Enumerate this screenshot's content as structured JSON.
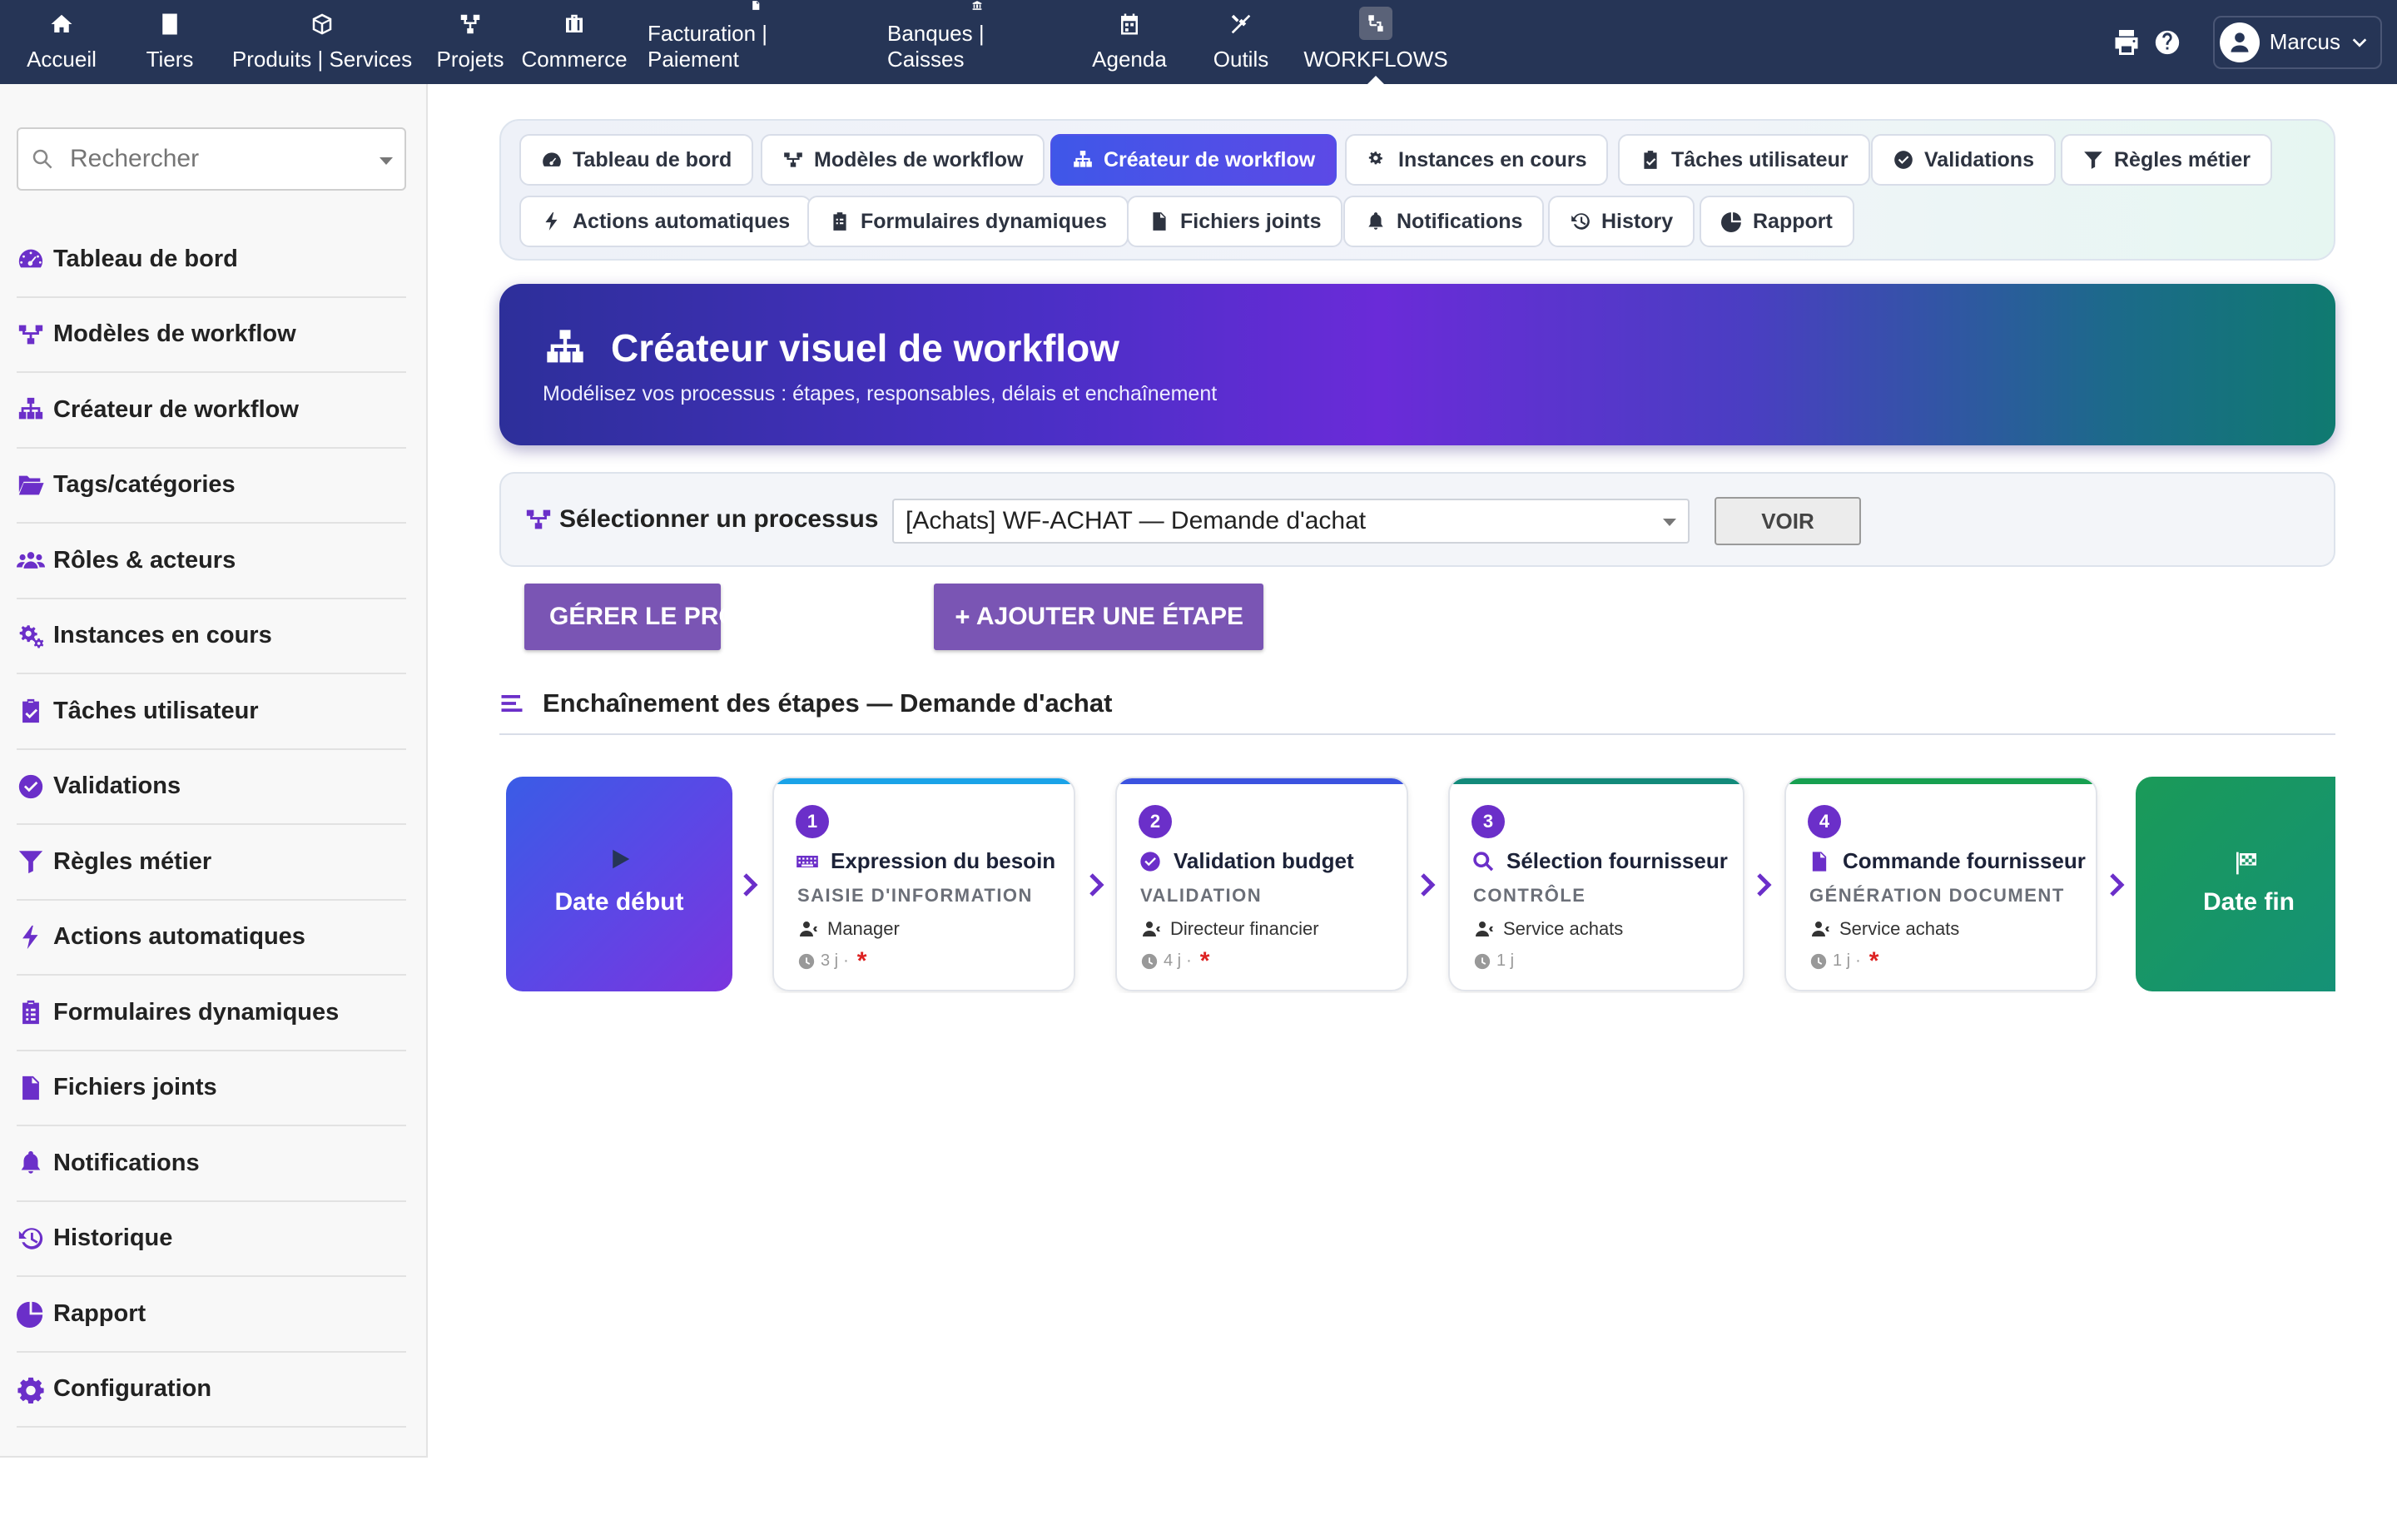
{
  "topnav": [
    {
      "label": "Accueil",
      "icon": "home-icon"
    },
    {
      "label": "Tiers",
      "icon": "building-icon"
    },
    {
      "label": "Produits | Services",
      "icon": "cube-icon"
    },
    {
      "label": "Projets",
      "icon": "project-icon"
    },
    {
      "label": "Commerce",
      "icon": "briefcase-icon"
    },
    {
      "label": "Facturation | Paiement",
      "icon": "invoice-icon"
    },
    {
      "label": "Banques | Caisses",
      "icon": "bank-icon"
    },
    {
      "label": "Agenda",
      "icon": "calendar-icon"
    },
    {
      "label": "Outils",
      "icon": "tools-icon"
    },
    {
      "label": "WORKFLOWS",
      "icon": "workflow-icon"
    }
  ],
  "user": {
    "name": "Marcus"
  },
  "sidebar": {
    "search_placeholder": "Rechercher",
    "items": [
      {
        "label": "Tableau de bord"
      },
      {
        "label": "Modèles de workflow"
      },
      {
        "label": "Créateur de workflow"
      },
      {
        "label": "Tags/catégories"
      },
      {
        "label": "Rôles & acteurs"
      },
      {
        "label": "Instances en cours"
      },
      {
        "label": "Tâches utilisateur"
      },
      {
        "label": "Validations"
      },
      {
        "label": "Règles métier"
      },
      {
        "label": "Actions automatiques"
      },
      {
        "label": "Formulaires dynamiques"
      },
      {
        "label": "Fichiers joints"
      },
      {
        "label": "Notifications"
      },
      {
        "label": "Historique"
      },
      {
        "label": "Rapport"
      },
      {
        "label": "Configuration"
      }
    ]
  },
  "tabs": [
    {
      "label": "Tableau de bord"
    },
    {
      "label": "Modèles de workflow"
    },
    {
      "label": "Créateur de workflow",
      "active": true
    },
    {
      "label": "Instances en cours"
    },
    {
      "label": "Tâches utilisateur"
    },
    {
      "label": "Validations"
    },
    {
      "label": "Règles métier"
    },
    {
      "label": "Actions automatiques"
    },
    {
      "label": "Formulaires dynamiques"
    },
    {
      "label": "Fichiers joints"
    },
    {
      "label": "Notifications"
    },
    {
      "label": "History"
    },
    {
      "label": "Rapport"
    }
  ],
  "hero": {
    "title": "Créateur visuel de workflow",
    "subtitle": "Modélisez vos processus : étapes, responsables, délais et enchaînement"
  },
  "process_select": {
    "label": "Sélectionner un processus",
    "selected": "[Achats] WF-ACHAT — Demande d'achat",
    "button": "VOIR"
  },
  "actions": {
    "manage": "GÉRER LE PROCESSUS",
    "add_step": "AJOUTER UNE ÉTAPE"
  },
  "section": {
    "title": "Enchaînement des étapes — Demande d'achat"
  },
  "flow": {
    "start_label": "Date début",
    "end_label": "Date fin",
    "steps": [
      {
        "num": "1",
        "title": "Expression du besoin",
        "type": "SAISIE D'INFORMATION",
        "role": "Manager",
        "delay": "3 j",
        "required": true,
        "color": "#1aa3e8",
        "icon": "keyboard-icon"
      },
      {
        "num": "2",
        "title": "Validation budget",
        "type": "VALIDATION",
        "role": "Directeur financier",
        "delay": "4 j",
        "required": true,
        "color": "#3b53e0",
        "icon": "check-circle-icon"
      },
      {
        "num": "3",
        "title": "Sélection fournisseur",
        "type": "CONTRÔLE",
        "role": "Service achats",
        "delay": "1 j",
        "required": false,
        "color": "#138a7a",
        "icon": "search-icon"
      },
      {
        "num": "4",
        "title": "Commande fournisseur",
        "type": "GÉNÉRATION DOCUMENT",
        "role": "Service achats",
        "delay": "1 j",
        "required": true,
        "color": "#17a050",
        "icon": "document-icon"
      }
    ]
  }
}
